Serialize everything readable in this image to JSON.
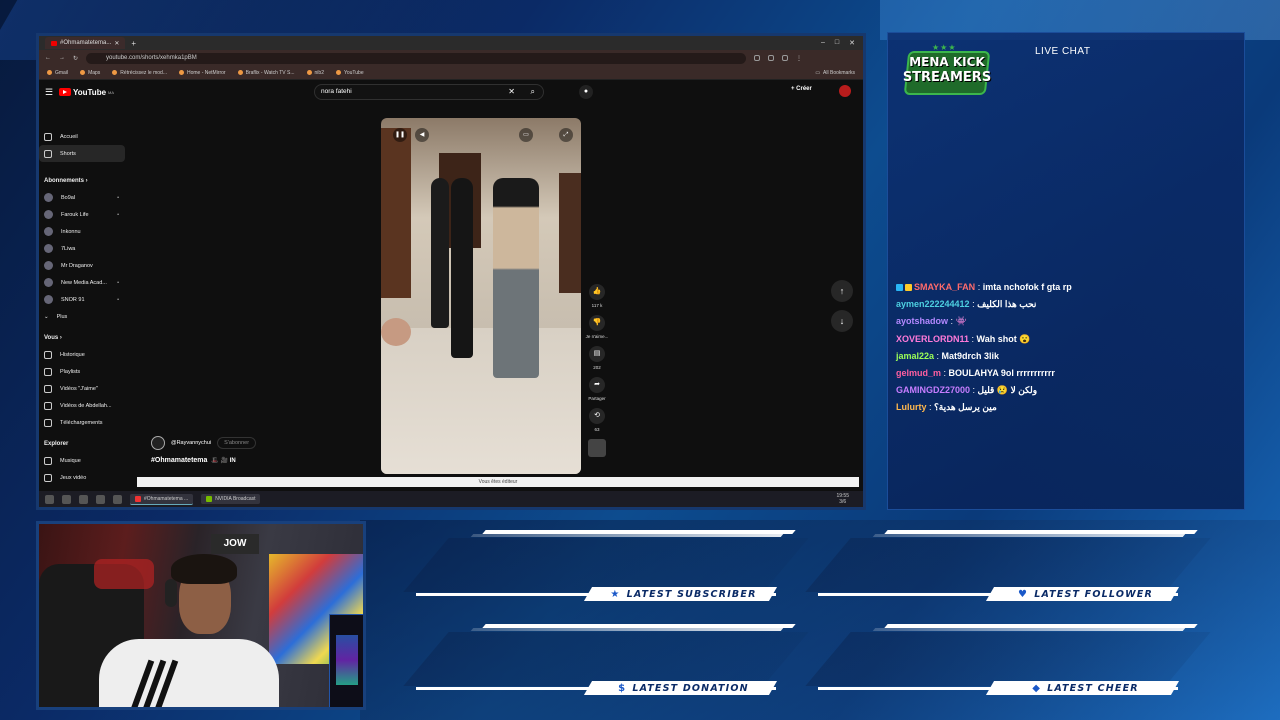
{
  "browser": {
    "tab_title": "#Ohmamatetema...",
    "url": "youtube.com/shorts/xehmka1pBM",
    "bookmarks": [
      "Gmail",
      "Maps",
      "Rétrécissez le mod...",
      "Home - NetMirror",
      "Braflix - Watch TV S...",
      "nib2",
      "YouTube"
    ],
    "all_bookmarks": "All Bookmarks"
  },
  "youtube": {
    "logo": "YouTube",
    "logo_sup": "MA",
    "search_value": "nora fatehi",
    "create_label": "Créer",
    "nav": [
      {
        "label": "Accueil",
        "icon": "home-icon"
      },
      {
        "label": "Shorts",
        "icon": "shorts-icon"
      }
    ],
    "subs_header": "Abonnements ›",
    "subs": [
      {
        "label": "Bo9al",
        "dot": "•"
      },
      {
        "label": "Farouk Life",
        "dot": "•"
      },
      {
        "label": "Inkonnu",
        "dot": ""
      },
      {
        "label": "7Liwa",
        "dot": ""
      },
      {
        "label": "Mr Draganov",
        "dot": ""
      },
      {
        "label": "New Media Acad...",
        "dot": "•"
      },
      {
        "label": "SNOR 91",
        "dot": "•"
      }
    ],
    "more_label": "Plus",
    "you_header": "Vous ›",
    "you_items": [
      "Historique",
      "Playlists",
      "Vidéos \"J'aime\"",
      "Vidéos de Abdellah...",
      "Téléchargements"
    ],
    "explore_header": "Explorer",
    "explore_items": [
      "Musique",
      "Jeux vidéo"
    ],
    "channel_name": "@Rayvannychui",
    "subscribe_label": "S'abonner",
    "caption": "#Ohmamatetema",
    "caption_emoji": "🎩 🎥 IN",
    "actions": [
      {
        "icon": "like-icon",
        "label": "117 k"
      },
      {
        "icon": "dislike-icon",
        "label": "Je n'aime..."
      },
      {
        "icon": "comment-icon",
        "label": "202"
      },
      {
        "icon": "share-icon",
        "label": "Partager"
      },
      {
        "icon": "remix-icon",
        "label": "63"
      }
    ],
    "editor_banner": "Vous êtes éditeur"
  },
  "taskbar": {
    "tasks": [
      "#Ohmamatetema ...",
      "NVIDIA Broadcast"
    ],
    "time": "19:55",
    "date": "3/6"
  },
  "chat": {
    "logo_line1": "MENA KICK",
    "logo_line2": "STREAMERS",
    "title": "LIVE CHAT",
    "messages": [
      {
        "user": "SMAYKA_FAN",
        "text": "imta nchofok f gta rp",
        "color": "#ff6b6b",
        "badge": true
      },
      {
        "user": "aymen222244412",
        "text": "نحب هذا الكليف",
        "color": "#4dd0e1",
        "badge": false
      },
      {
        "user": "ayotshadow",
        "text": "👾",
        "color": "#b388ff",
        "badge": false
      },
      {
        "user": "XOVERLORDN11",
        "text": "Wah shot 😮",
        "color": "#ff7ad9",
        "badge": false
      },
      {
        "user": "jamal22a",
        "text": "Mat9drch 3lik",
        "color": "#9cff57",
        "badge": false
      },
      {
        "user": "gelmud_m",
        "text": "BOULAHYA 9ol rrrrrrrrrrr",
        "color": "#ff5fa0",
        "badge": false
      },
      {
        "user": "GAMINGDZ27000",
        "text": "ولكن لا 😢 قليل",
        "color": "#c77dff",
        "badge": false
      },
      {
        "user": "Lulurty",
        "text": "مين يرسل هدية؟",
        "color": "#ffb74d",
        "badge": false
      }
    ]
  },
  "webcam": {
    "sign": "JOW"
  },
  "alerts": [
    {
      "label": "LATEST SUBSCRIBER",
      "icon": "star-icon",
      "glyph": "★"
    },
    {
      "label": "LATEST FOLLOWER",
      "icon": "heart-icon",
      "glyph": "♥"
    },
    {
      "label": "LATEST DONATION",
      "icon": "dollar-icon",
      "glyph": "$"
    },
    {
      "label": "LATEST CHEER",
      "icon": "diamond-icon",
      "glyph": "◆"
    }
  ]
}
